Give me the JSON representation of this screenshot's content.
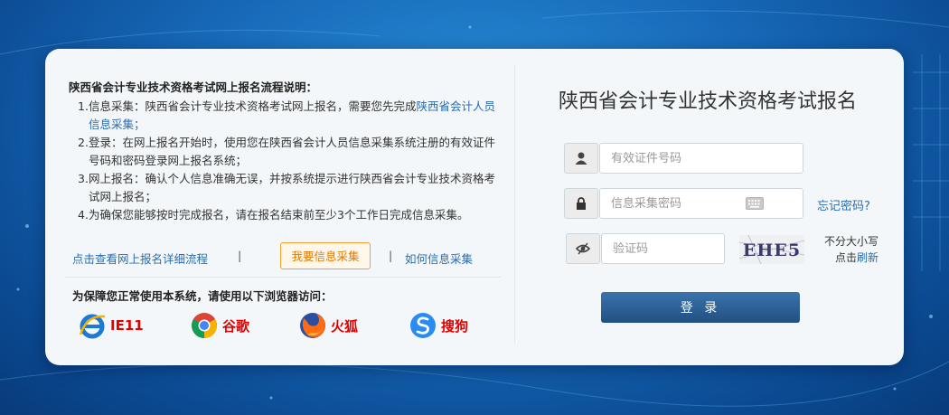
{
  "intro": {
    "title": "陕西省会计专业技术资格考试网上报名流程说明：",
    "steps": [
      {
        "num": "1.",
        "text": "信息采集：陕西省会计专业技术资格考试网上报名，需要您先完成",
        "link": "陕西省会计人员信息采集",
        "tail": "；"
      },
      {
        "num": "2.",
        "text": "登录：在网上报名开始时，使用您在陕西省会计人员信息采集系统注册的有效证件号码和密码登录网上报名系统；"
      },
      {
        "num": "3.",
        "text": "网上报名：确认个人信息准确无误，并按系统提示进行陕西省会计专业技术资格考试网上报名；"
      },
      {
        "num": "4.",
        "text": "为确保您能够按时完成报名，请在报名结束前至少3个工作日完成信息采集。"
      }
    ]
  },
  "links": {
    "detail": "点击查看网上报名详细流程",
    "separator": "|",
    "collect_button": "我要信息采集",
    "how_to": "如何信息采集"
  },
  "browsers": {
    "title": "为保障您正常使用本系统，请使用以下浏览器访问：",
    "items": [
      {
        "name": "IE11",
        "icon": "ie-icon"
      },
      {
        "name": "谷歌",
        "icon": "chrome-icon"
      },
      {
        "name": "火狐",
        "icon": "firefox-icon"
      },
      {
        "name": "搜狗",
        "icon": "sogou-icon"
      }
    ]
  },
  "login": {
    "title": "陕西省会计专业技术资格考试报名",
    "id_placeholder": "有效证件号码",
    "password_placeholder": "信息采集密码",
    "forgot": "忘记密码?",
    "captcha_placeholder": "验证码",
    "captcha_text": "EHE5",
    "case_hint": "不分大小写",
    "click": "点击",
    "refresh": "刷新",
    "submit": "登 录"
  }
}
